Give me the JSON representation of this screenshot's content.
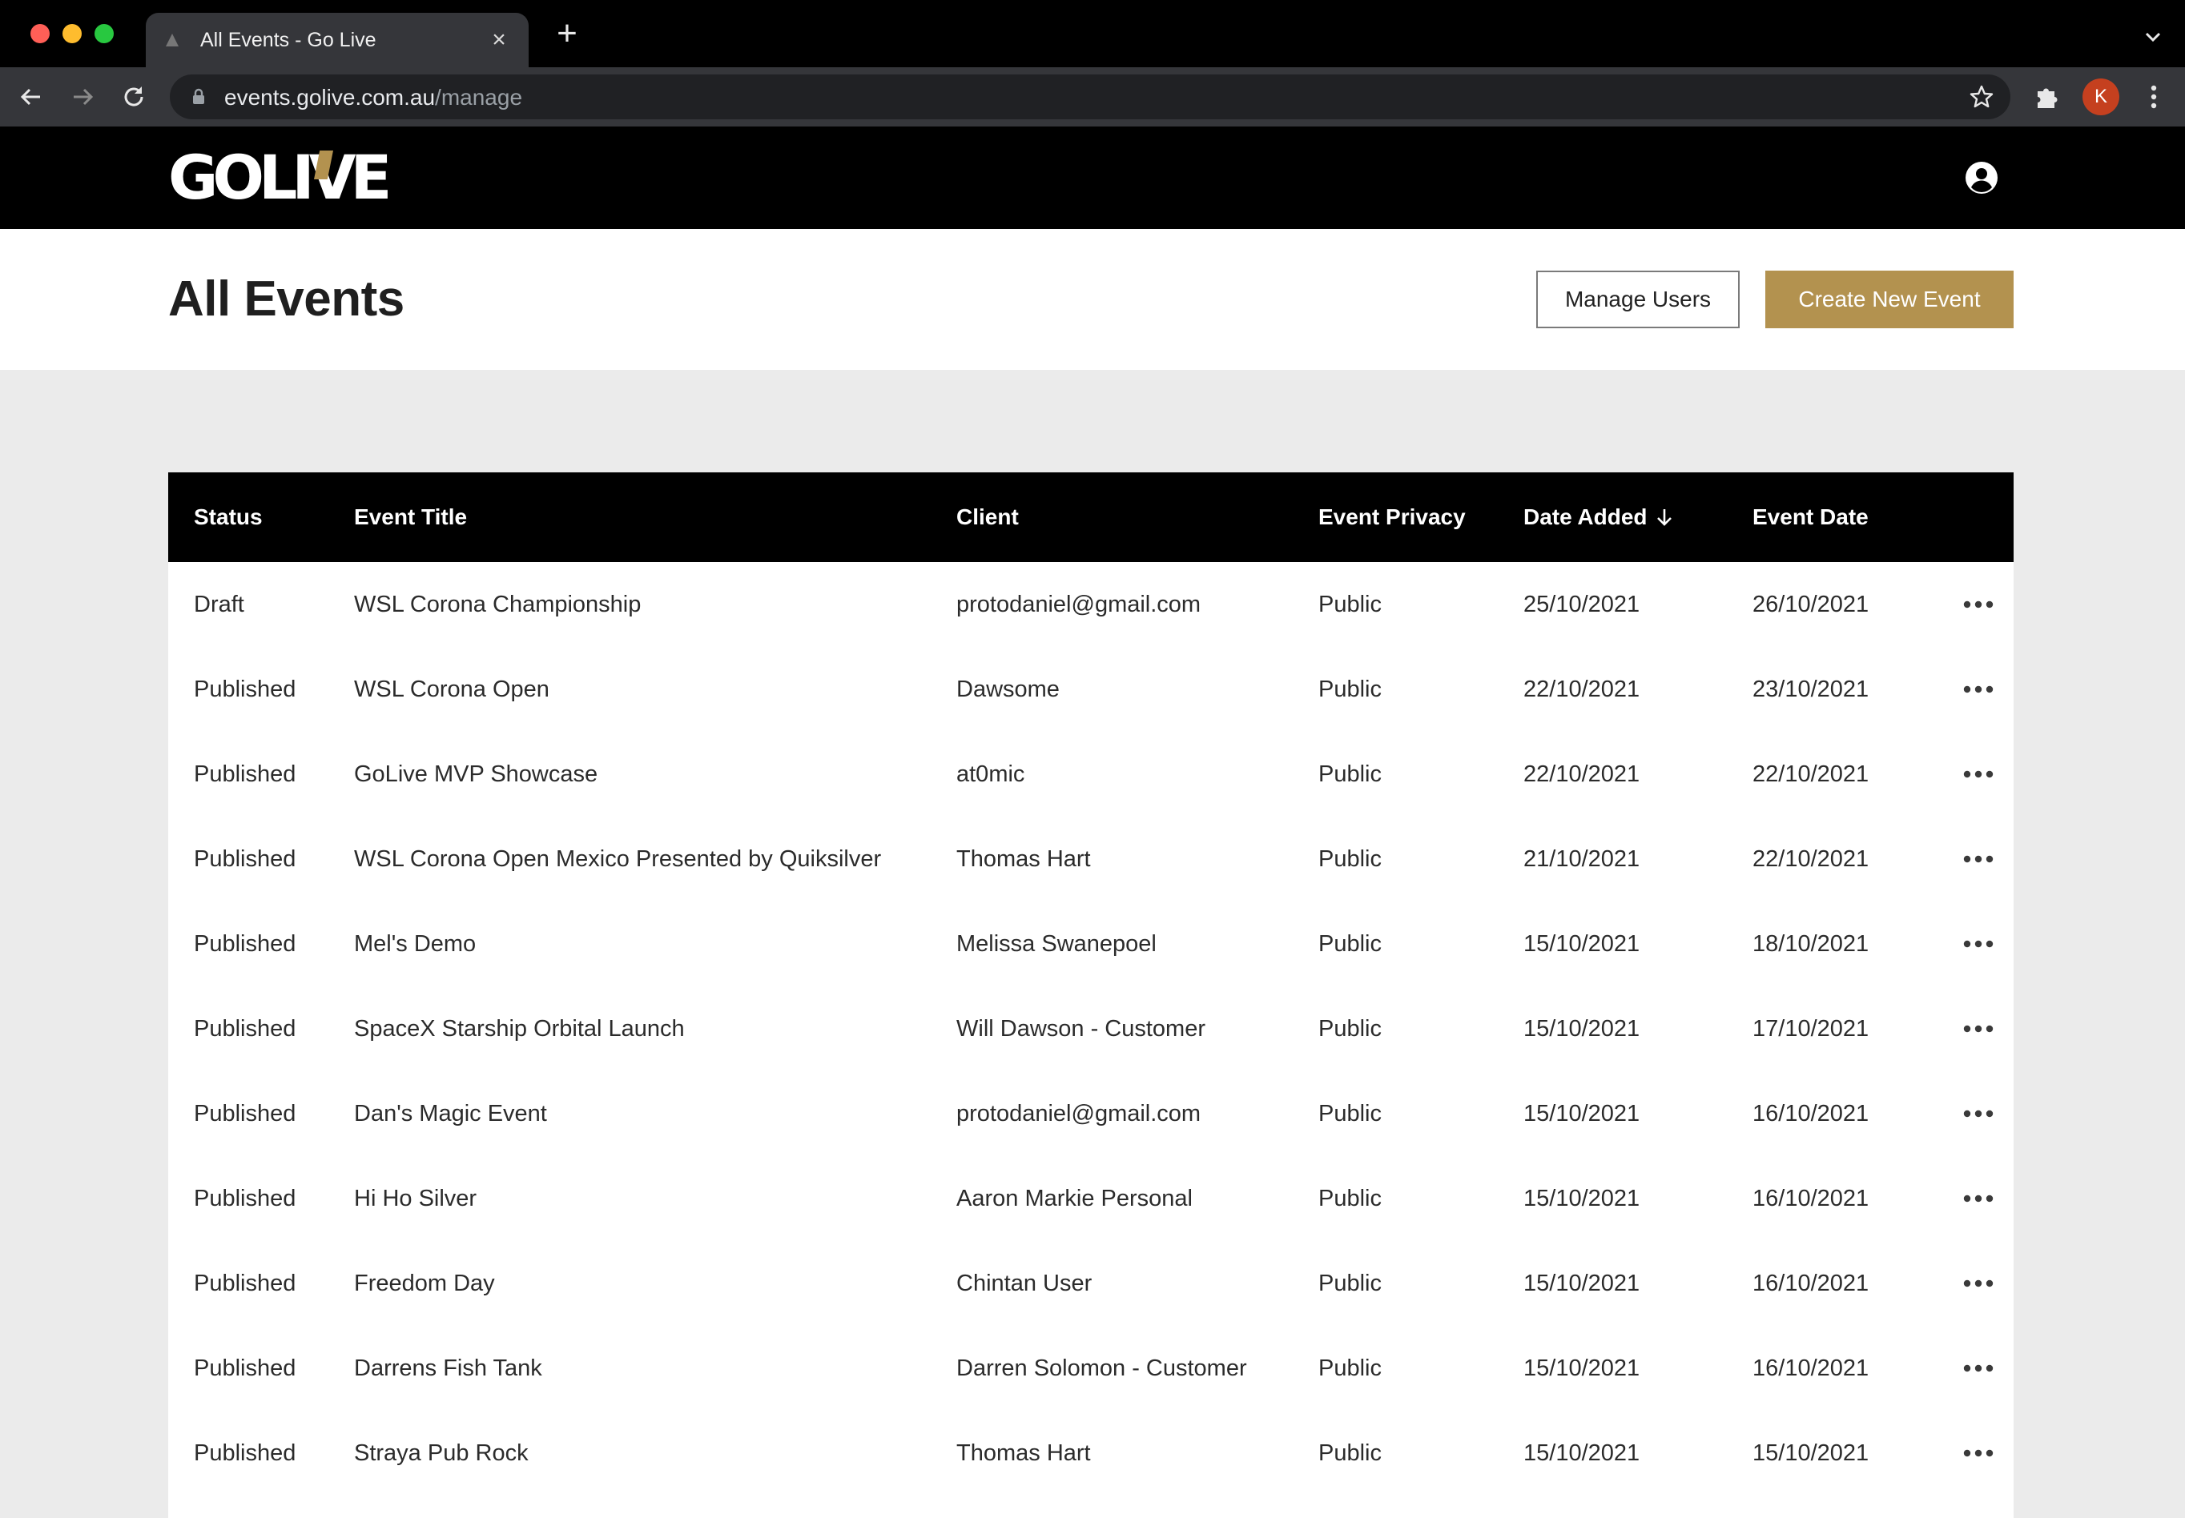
{
  "browser": {
    "tab_title": "All Events - Go Live",
    "url_host": "events.golive.com.au",
    "url_path": "/manage",
    "profile_initial": "K"
  },
  "site": {
    "logo_text": "GOLIVE",
    "brand_color": "#b3924f"
  },
  "page": {
    "title": "All Events",
    "manage_users_label": "Manage Users",
    "create_event_label": "Create New Event"
  },
  "table": {
    "columns": {
      "status": "Status",
      "event_title": "Event Title",
      "client": "Client",
      "privacy": "Event Privacy",
      "date_added": "Date Added",
      "event_date": "Event Date"
    },
    "sorted_by": "date_added",
    "sort_direction": "descending",
    "rows": [
      {
        "status": "Draft",
        "title": "WSL Corona Championship",
        "client": "protodaniel@gmail.com",
        "privacy": "Public",
        "date_added": "25/10/2021",
        "event_date": "26/10/2021"
      },
      {
        "status": "Published",
        "title": "WSL Corona Open",
        "client": "Dawsome",
        "privacy": "Public",
        "date_added": "22/10/2021",
        "event_date": "23/10/2021"
      },
      {
        "status": "Published",
        "title": "GoLive MVP Showcase",
        "client": "at0mic",
        "privacy": "Public",
        "date_added": "22/10/2021",
        "event_date": "22/10/2021"
      },
      {
        "status": "Published",
        "title": "WSL Corona Open Mexico Presented by Quiksilver",
        "client": "Thomas Hart",
        "privacy": "Public",
        "date_added": "21/10/2021",
        "event_date": "22/10/2021"
      },
      {
        "status": "Published",
        "title": "Mel's Demo",
        "client": "Melissa Swanepoel",
        "privacy": "Public",
        "date_added": "15/10/2021",
        "event_date": "18/10/2021"
      },
      {
        "status": "Published",
        "title": "SpaceX Starship Orbital Launch",
        "client": "Will Dawson - Customer",
        "privacy": "Public",
        "date_added": "15/10/2021",
        "event_date": "17/10/2021"
      },
      {
        "status": "Published",
        "title": "Dan's Magic Event",
        "client": "protodaniel@gmail.com",
        "privacy": "Public",
        "date_added": "15/10/2021",
        "event_date": "16/10/2021"
      },
      {
        "status": "Published",
        "title": "Hi Ho Silver",
        "client": "Aaron Markie Personal",
        "privacy": "Public",
        "date_added": "15/10/2021",
        "event_date": "16/10/2021"
      },
      {
        "status": "Published",
        "title": "Freedom Day",
        "client": "Chintan User",
        "privacy": "Public",
        "date_added": "15/10/2021",
        "event_date": "16/10/2021"
      },
      {
        "status": "Published",
        "title": "Darrens Fish Tank",
        "client": "Darren Solomon - Customer",
        "privacy": "Public",
        "date_added": "15/10/2021",
        "event_date": "16/10/2021"
      },
      {
        "status": "Published",
        "title": "Straya Pub Rock",
        "client": "Thomas Hart",
        "privacy": "Public",
        "date_added": "15/10/2021",
        "event_date": "15/10/2021"
      }
    ]
  }
}
